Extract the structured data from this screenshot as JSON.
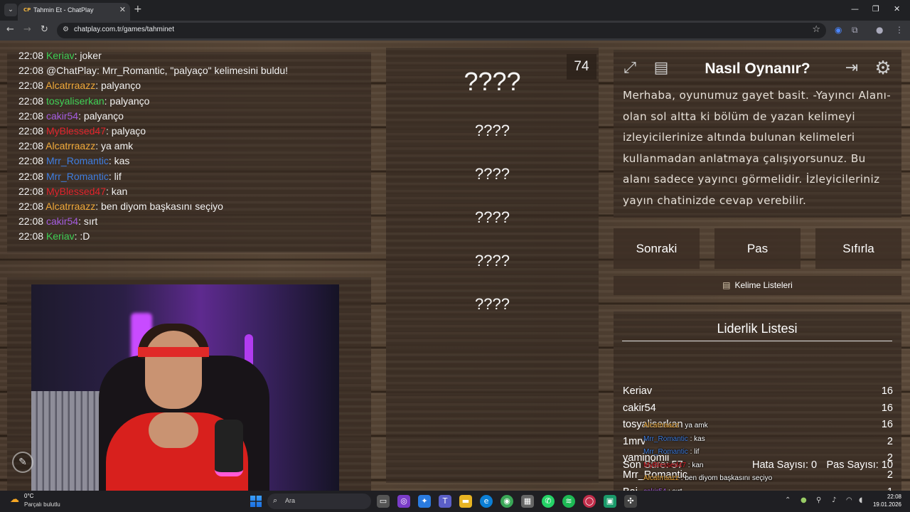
{
  "browser": {
    "tab_title": "Tahmin Et - ChatPlay",
    "tab_favicon": "CP",
    "url": "chatplay.com.tr/games/tahminet"
  },
  "chat": {
    "lines": [
      {
        "time": "22:08",
        "user": "Keriav",
        "msg": ": joker",
        "color": "#3ecf55"
      },
      {
        "time": "22:08",
        "user": "@ChatPlay",
        "msg": ": Mrr_Romantic, \"palyaço\" kelimesini buldu!",
        "color": "#f2f2f2"
      },
      {
        "time": "22:08",
        "user": "Alcatrraazz",
        "msg": ": palyanço",
        "color": "#f0a93a"
      },
      {
        "time": "22:08",
        "user": "tosyaliserkan",
        "msg": ": palyanço",
        "color": "#3ecf55"
      },
      {
        "time": "22:08",
        "user": "cakir54",
        "msg": ": palyanço",
        "color": "#a45ce0"
      },
      {
        "time": "22:08",
        "user": "MyBlessed47",
        "msg": ": palyaço",
        "color": "#e0242c"
      },
      {
        "time": "22:08",
        "user": "Alcatrraazz",
        "msg": ": ya amk",
        "color": "#f0a93a"
      },
      {
        "time": "22:08",
        "user": "Mrr_Romantic",
        "msg": ": kas",
        "color": "#3e7de0"
      },
      {
        "time": "22:08",
        "user": "Mrr_Romantic",
        "msg": ": lif",
        "color": "#3e7de0"
      },
      {
        "time": "22:08",
        "user": "MyBlessed47",
        "msg": ": kan",
        "color": "#e0242c"
      },
      {
        "time": "22:08",
        "user": "Alcatrraazz",
        "msg": ": ben diyom başkasını seçiyo",
        "color": "#f0a93a"
      },
      {
        "time": "22:08",
        "user": "cakir54",
        "msg": ": sırt",
        "color": "#a45ce0"
      },
      {
        "time": "22:08",
        "user": "Keriav",
        "msg": ": :D",
        "color": "#3ecf55"
      }
    ]
  },
  "game": {
    "timer": "74",
    "words": [
      "????",
      "????",
      "????",
      "????",
      "????",
      "????"
    ]
  },
  "howto": {
    "title": "Nasıl Oynanır?",
    "text": "Merhaba, oyunumuz gayet basit. -Yayıncı Alanı- olan sol altta ki bölüm de yazan kelimeyi izleyicilerinize altında bulunan kelimeleri kullanmadan anlatmaya çalışıyorsunuz. Bu alanı sadece yayıncı görmelidir. İzleyicileriniz yayın chatinizde cevap verebilir."
  },
  "buttons": {
    "next": "Sonraki",
    "pass": "Pas",
    "reset": "Sıfırla",
    "word_lists": "Kelime Listeleri"
  },
  "leaderboard": {
    "title": "Liderlik Listesi",
    "rows": [
      {
        "name": "Keriav",
        "score": "16"
      },
      {
        "name": "cakir54",
        "score": "16"
      },
      {
        "name": "tosyaliserkan",
        "score": "16"
      },
      {
        "name": "1mrv",
        "score": "2"
      },
      {
        "name": "yaminomii",
        "score": "2"
      },
      {
        "name": "Mrr_Romantic",
        "score": "2"
      },
      {
        "name": "Bai...",
        "score": "1"
      }
    ],
    "stats": {
      "last_label": "Son Süre: 57",
      "errors": "Hata Sayısı: 0",
      "passes": "Pas Sayısı: 10"
    }
  },
  "overlay_chat": [
    {
      "user": "Alcatrraazz",
      "msg": " : ya amk",
      "color": "#f0a93a"
    },
    {
      "user": "Mrr_Romantic",
      "msg": " : kas",
      "color": "#3e7de0"
    },
    {
      "user": "Mrr_Romantic",
      "msg": " : lif",
      "color": "#3e7de0"
    },
    {
      "user": "MyBlessed47",
      "msg": " : kan",
      "color": "#e0242c"
    },
    {
      "user": "Alcatrraazz",
      "msg": " : ben diyom başkasını seçiyo",
      "color": "#f0a93a"
    },
    {
      "user": "cakir54",
      "msg": " : sırt",
      "color": "#a45ce0"
    },
    {
      "user": "Keriav",
      "msg": " : :D",
      "color": "#3ecf55"
    }
  ],
  "taskbar": {
    "temperature": "0°C",
    "weather": "Parçalı bulutlu",
    "search_label": "Ara",
    "time": "22:08",
    "date": "19.01.2026"
  }
}
